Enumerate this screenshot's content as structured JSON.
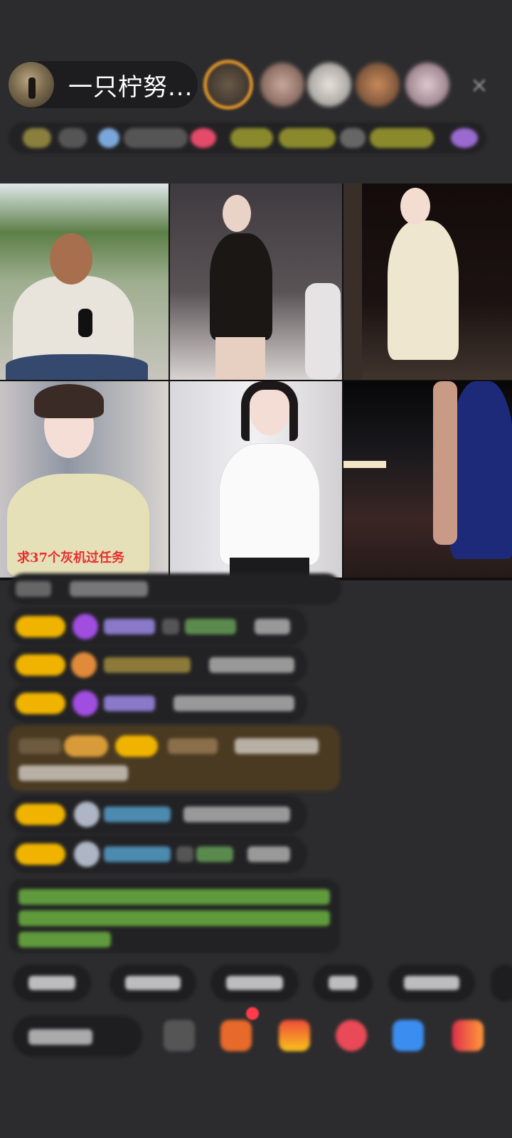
{
  "header": {
    "host_name": "一只柠努...",
    "close_icon": "✕"
  },
  "grid": {
    "caption": "求37个灰机过任务"
  },
  "colors": {
    "background": "#2c2c2e",
    "pill": "#1d1d1f",
    "badge_yellow": "#f0b400",
    "chat_green": "#6ab04c",
    "red_dot": "#ff3b4b"
  },
  "icons": [
    "user-avatar-icon",
    "close-icon",
    "gift-icon",
    "heart-icon",
    "share-icon"
  ]
}
